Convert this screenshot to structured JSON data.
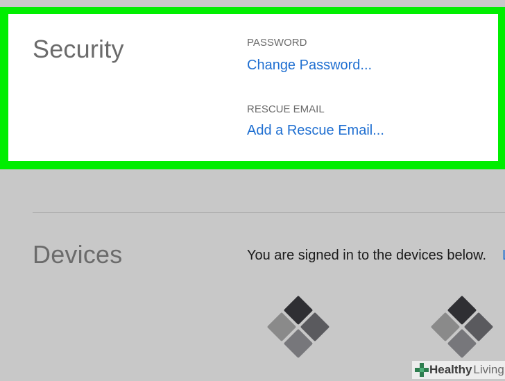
{
  "security": {
    "title": "Security",
    "password_label": "PASSWORD",
    "password_link": "Change Password...",
    "rescue_label": "RESCUE EMAIL",
    "rescue_link": "Add a Rescue Email..."
  },
  "devices": {
    "title": "Devices",
    "description": "You are signed in to the devices below.",
    "description_link": "L",
    "items": [
      {
        "icon": "windows-device-icon"
      },
      {
        "icon": "windows-device-icon"
      }
    ]
  },
  "watermark": {
    "brand_bold": "Healthy",
    "brand_light": "Living"
  },
  "colors": {
    "highlight": "#00ee00",
    "link": "#1f6fd1",
    "background": "#c8c8c8"
  }
}
